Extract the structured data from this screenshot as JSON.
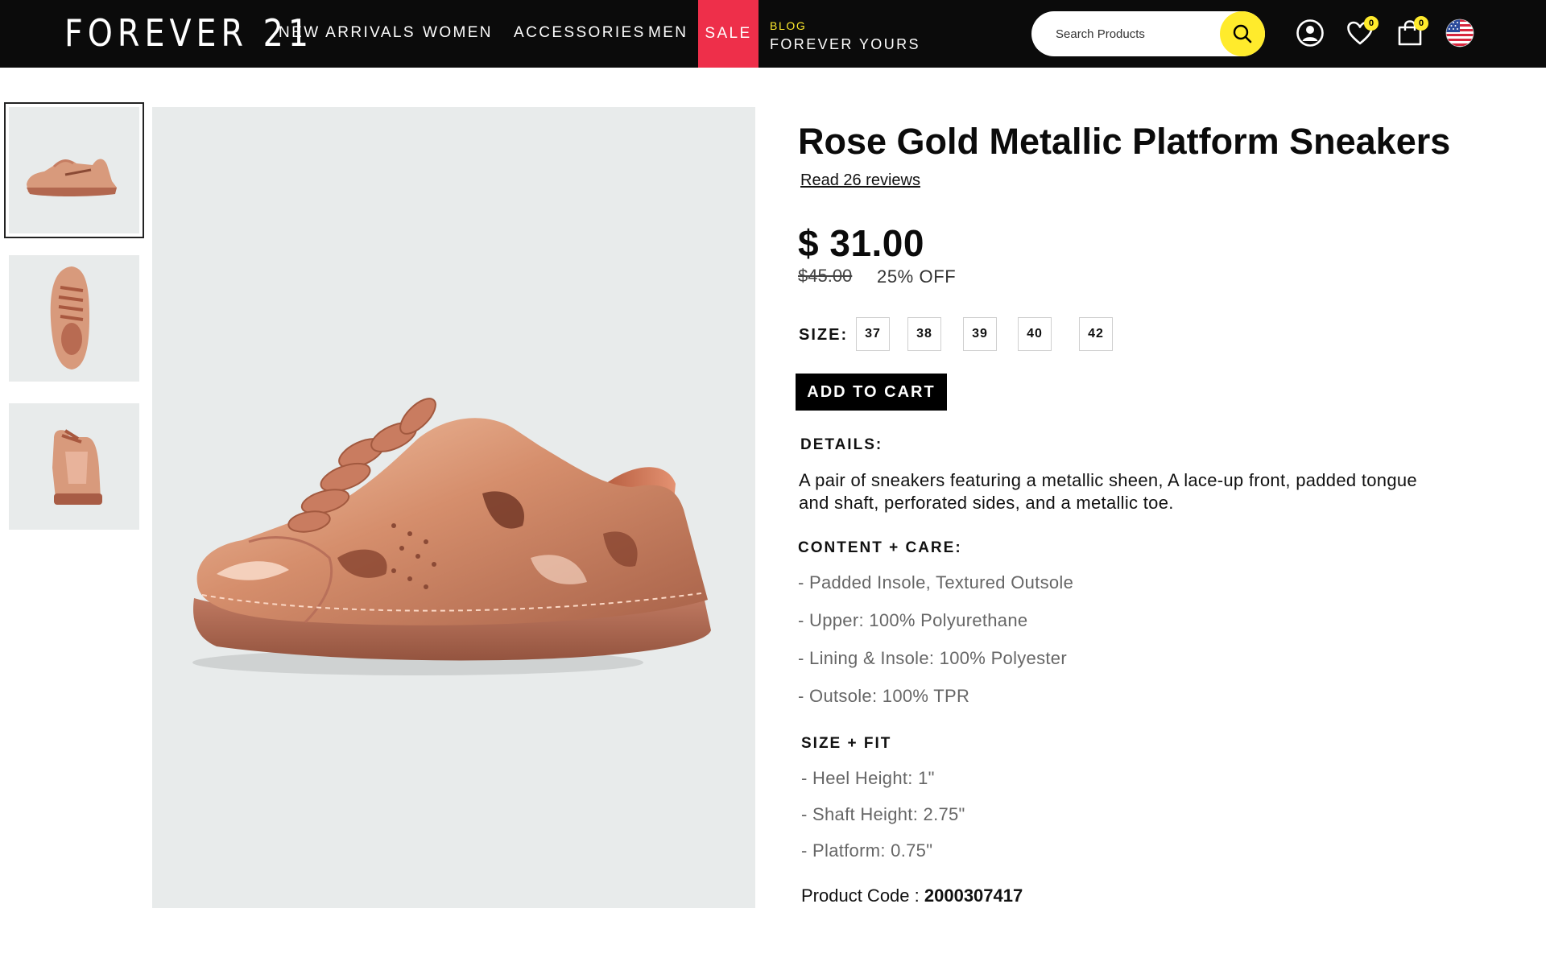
{
  "header": {
    "logo": "FOREVER 21",
    "nav": [
      "NEW ARRIVALS",
      "WOMEN",
      "ACCESSORIES",
      "MEN"
    ],
    "sale": "SALE",
    "blog_small": "BLOG",
    "blog_title": "FOREVER YOURS",
    "search_placeholder": "Search Products",
    "wishlist_count": "0",
    "cart_count": "0",
    "accent_color": "#ffeb2c",
    "sale_color": "#ee2f4a",
    "icons": [
      "search-icon",
      "account-icon",
      "heart-icon",
      "bag-icon",
      "us-flag-icon"
    ]
  },
  "gallery": {
    "thumbnails": [
      "shoe-side-view",
      "shoe-top-view",
      "shoe-back-view"
    ],
    "active_index": 0
  },
  "product": {
    "title": "Rose Gold Metallic Platform Sneakers",
    "reviews_link": "Read 26 reviews",
    "price": "$ 31.00",
    "old_price": "$45.00",
    "discount": "25% OFF",
    "size_label": "SIZE:",
    "sizes": [
      "37",
      "38",
      "39",
      "40",
      "42"
    ],
    "add_to_cart": "ADD TO CART",
    "details_heading": "DETAILS:",
    "details_text": "A pair of sneakers featuring a metallic sheen, A lace-up front, padded tongue and shaft, perforated sides, and a metallic toe.",
    "care_heading": "CONTENT + CARE:",
    "care_items": [
      "- Padded Insole, Textured Outsole",
      "- Upper: 100% Polyurethane",
      "- Lining & Insole: 100% Polyester",
      "- Outsole: 100% TPR"
    ],
    "fit_heading": "SIZE + FIT",
    "fit_items": [
      "- Heel Height: 1\"",
      "- Shaft Height: 2.75\"",
      "- Platform: 0.75\""
    ],
    "code_label": "Product Code :",
    "code_value": "2000307417"
  }
}
